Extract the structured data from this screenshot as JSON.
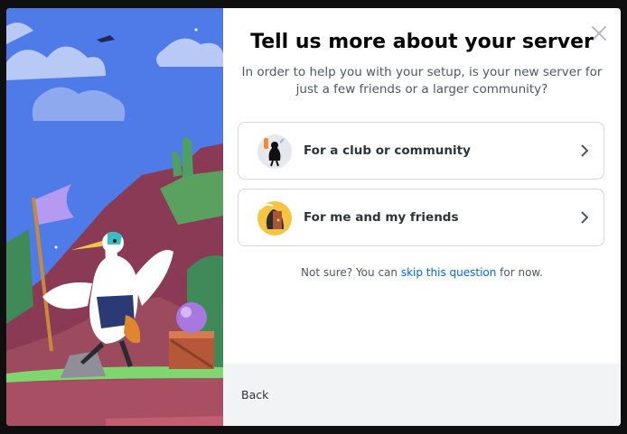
{
  "modal": {
    "title": "Tell us more about your server",
    "subtitle": "In order to help you with your setup, is your new server for just a few friends or a larger community?",
    "close_icon": "close-icon"
  },
  "options": [
    {
      "label": "For a club or community",
      "icon": "club-community-icon",
      "chevron": "chevron-right-icon"
    },
    {
      "label": "For me and my friends",
      "icon": "friends-icon",
      "chevron": "chevron-right-icon"
    }
  ],
  "not_sure": {
    "prefix": "Not sure? You can ",
    "link": "skip this question",
    "suffix": " for now."
  },
  "footer": {
    "back_label": "Back"
  },
  "illustration": "bird-adventurer-illustration"
}
